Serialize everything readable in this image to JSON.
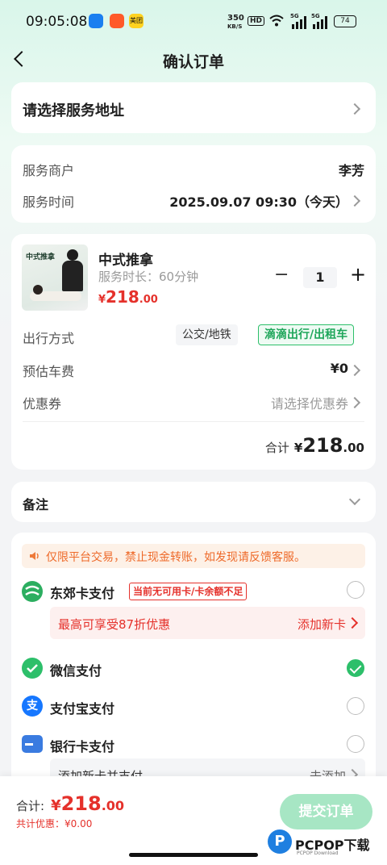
{
  "status_bar": {
    "time": "09:05:08",
    "app_icon_1": "blue-arrow",
    "app_icon_2": "orange-app",
    "app_icon_3_label": "美团",
    "net_speed_top": "350",
    "net_speed_unit": "KB/S",
    "hd_label": "HD",
    "sig1": "5G",
    "sig2": "5G",
    "battery": "74"
  },
  "header": {
    "title": "确认订单"
  },
  "address": {
    "label": "请选择服务地址"
  },
  "service_info": {
    "merchant_label": "服务商户",
    "merchant_value": "李芳",
    "time_label": "服务时间",
    "time_value": "2025.09.07 09:30（今天）"
  },
  "product": {
    "thumb_title": "中式推拿",
    "name": "中式推拿",
    "duration": "服务时长：60分钟",
    "currency": "¥",
    "price_int": "218",
    "price_dec": ".00",
    "qty": "1",
    "minus": "−",
    "plus": "+"
  },
  "travel": {
    "label": "出行方式",
    "option_1": "公交/地铁",
    "option_2": "滴滴出行/出租车",
    "selected": "滴滴出行/出租车"
  },
  "fare": {
    "label": "预估车费",
    "value": "¥0"
  },
  "coupon": {
    "label": "优惠券",
    "value": "请选择优惠券"
  },
  "subtotal": {
    "label": "合计",
    "currency": "¥",
    "int": "218",
    "dec": ".00"
  },
  "remark": {
    "label": "备注"
  },
  "payment": {
    "notice": "仅限平台交易，禁止现金转账，如发现请反馈客服。",
    "dongjiao": {
      "label": "东郊卡支付",
      "badge": "当前无可用卡/卡余额不足",
      "promo": "最高可享受87折优惠",
      "add_card": "添加新卡"
    },
    "wechat": {
      "label": "微信支付",
      "selected": true
    },
    "alipay": {
      "label": "支付宝支付",
      "icon_glyph": "支"
    },
    "bank": {
      "label": "银行卡支付",
      "sub_label": "添加新卡并支付",
      "sub_action": "去添加"
    }
  },
  "footer": {
    "total_label": "合计:",
    "currency": "¥",
    "total_int": "218",
    "total_dec": ".00",
    "discount": "共计优惠：¥0.00",
    "submit": "提交订单"
  },
  "watermark": {
    "text": "PCPOP下载",
    "sub": "PCPOP Download"
  },
  "colors": {
    "accent_green": "#2dbf6a",
    "price_red": "#e5312b",
    "submit_disabled": "#a7e6c4"
  }
}
